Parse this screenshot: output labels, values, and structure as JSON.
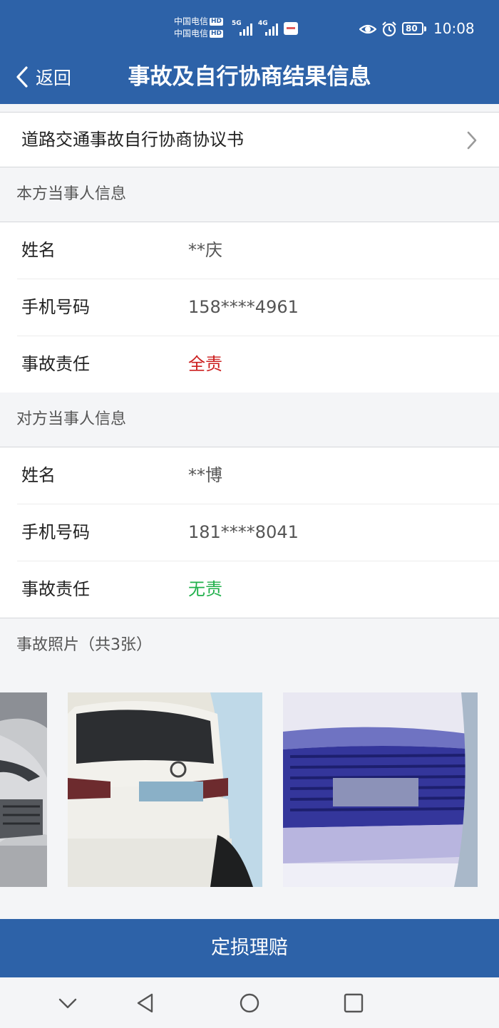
{
  "status": {
    "carrier1": "中国电信",
    "carrier2": "中国电信",
    "hd": "HD",
    "net1": "5G",
    "net2": "4G",
    "battery": "80",
    "time": "10:08"
  },
  "header": {
    "back_label": "返回",
    "title": "事故及自行协商结果信息"
  },
  "agreement": {
    "label": "道路交通事故自行协商协议书"
  },
  "party_self": {
    "section_title": "本方当事人信息",
    "name_label": "姓名",
    "name": "**庆",
    "phone_label": "手机号码",
    "phone": "158****4961",
    "liability_label": "事故责任",
    "liability": "全责"
  },
  "party_other": {
    "section_title": "对方当事人信息",
    "name_label": "姓名",
    "name": "**博",
    "phone_label": "手机号码",
    "phone": "181****8041",
    "liability_label": "事故责任",
    "liability": "无责"
  },
  "photos": {
    "title": "事故照片（共3张）"
  },
  "action": {
    "label": "定损理赔"
  },
  "colors": {
    "primary": "#2d62a8",
    "liability_full": "#cc1f1f",
    "liability_none": "#20b04b"
  }
}
